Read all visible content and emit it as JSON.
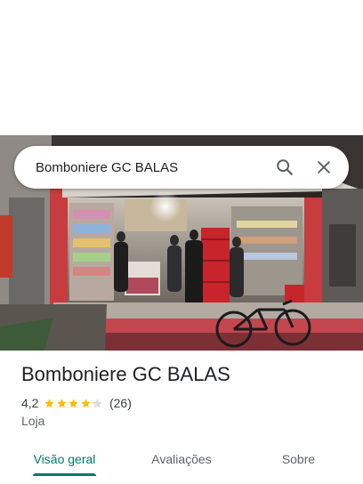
{
  "search": {
    "query": "Bomboniere GC BALAS"
  },
  "place": {
    "name": "Bomboniere GC BALAS",
    "rating": "4,2",
    "rating_value": 4.2,
    "stars_max": 5,
    "review_count": "(26)",
    "category": "Loja"
  },
  "tabs": [
    {
      "label": "Visão geral",
      "active": true
    },
    {
      "label": "Avaliações",
      "active": false
    },
    {
      "label": "Sobre",
      "active": false
    }
  ],
  "colors": {
    "accent": "#00796b",
    "star": "#fbbc04",
    "star_empty": "#dadce0"
  },
  "icons": {
    "search": "search-icon",
    "close": "close-icon"
  }
}
